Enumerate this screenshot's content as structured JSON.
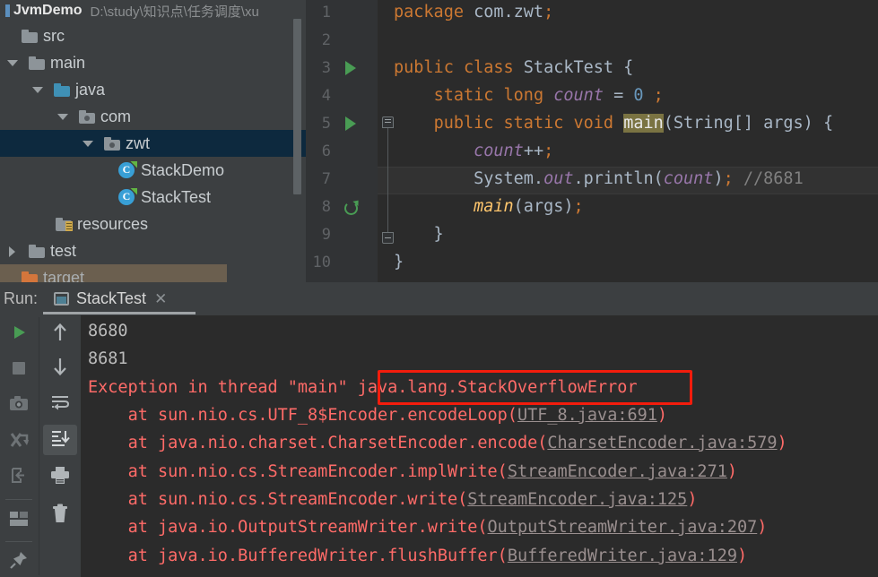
{
  "project": {
    "name": "JvmDemo",
    "path": "D:\\study\\知识点\\任务调度\\xu",
    "tree": [
      {
        "label": "src",
        "icon": "folder-icon",
        "arrow": "none",
        "indent": 8,
        "selected": false
      },
      {
        "label": "main",
        "icon": "folder-icon",
        "arrow": "down",
        "indent": 8,
        "selected": false
      },
      {
        "label": "java",
        "icon": "folder-blue-icon",
        "arrow": "down",
        "indent": 38,
        "selected": false
      },
      {
        "label": "com",
        "icon": "folder-package-icon",
        "arrow": "down",
        "indent": 68,
        "selected": false
      },
      {
        "label": "zwt",
        "icon": "folder-package-icon",
        "arrow": "down",
        "indent": 98,
        "selected": true
      },
      {
        "label": "StackDemo",
        "icon": "java-class-icon",
        "arrow": "none",
        "indent": 128,
        "selected": false
      },
      {
        "label": "StackTest",
        "icon": "java-class-icon",
        "arrow": "none",
        "indent": 128,
        "selected": false
      },
      {
        "label": "resources",
        "icon": "folder-resources-icon",
        "arrow": "none",
        "indent": 58,
        "selected": false
      },
      {
        "label": "test",
        "icon": "folder-icon",
        "arrow": "right",
        "indent": 8,
        "selected": false
      },
      {
        "label": "target",
        "icon": "folder-orange-icon",
        "arrow": "none",
        "indent": 8,
        "selected": false
      }
    ]
  },
  "editor": {
    "file": "StackTest.java",
    "line_numbers": [
      "1",
      "2",
      "3",
      "4",
      "5",
      "6",
      "7",
      "8",
      "9",
      "10"
    ],
    "code": [
      {
        "n": 1,
        "text": "package com.zwt;"
      },
      {
        "n": 2,
        "text": ""
      },
      {
        "n": 3,
        "text": "public class StackTest {"
      },
      {
        "n": 4,
        "text": "    static long count = 0 ;"
      },
      {
        "n": 5,
        "text": "    public static void main(String[] args) {"
      },
      {
        "n": 6,
        "text": "        count++;"
      },
      {
        "n": 7,
        "text": "        System.out.println(count); //8681"
      },
      {
        "n": 8,
        "text": "        main(args);"
      },
      {
        "n": 9,
        "text": "    }"
      },
      {
        "n": 10,
        "text": "}"
      }
    ],
    "comment": "//8681",
    "run_marker_lines": [
      3,
      5
    ],
    "recursion_marker_lines": [
      8
    ],
    "current_line": 7,
    "highlighted_symbol": "main"
  },
  "run_panel": {
    "label": "Run:",
    "tab_name": "StackTest",
    "tab_close": "✕",
    "toolbar_left": [
      {
        "name": "rerun-button",
        "icon": "play-icon",
        "interactable": true
      },
      {
        "name": "stop-button",
        "icon": "stop-icon",
        "interactable": true
      },
      {
        "name": "thread-dump-button",
        "icon": "camera-icon",
        "interactable": true
      },
      {
        "name": "restart-button",
        "icon": "rerun-failed-icon",
        "interactable": true
      },
      {
        "name": "export-button",
        "icon": "export-icon",
        "interactable": true
      },
      {
        "name": "layout-button",
        "icon": "layout-icon",
        "interactable": true
      },
      {
        "name": "pin-button",
        "icon": "pin-icon",
        "interactable": true
      }
    ],
    "toolbar_right": [
      {
        "name": "up-button",
        "icon": "arrow-up-icon",
        "interactable": true
      },
      {
        "name": "down-button",
        "icon": "arrow-down-icon",
        "interactable": true
      },
      {
        "name": "soft-wrap-button",
        "icon": "soft-wrap-icon",
        "interactable": true
      },
      {
        "name": "scroll-to-end-button",
        "icon": "scroll-to-end-icon",
        "interactable": true,
        "active": true
      },
      {
        "name": "print-button",
        "icon": "print-icon",
        "interactable": true
      },
      {
        "name": "clear-all-button",
        "icon": "trash-icon",
        "interactable": true
      }
    ],
    "console": [
      {
        "type": "out",
        "indent": 0,
        "text": "8680"
      },
      {
        "type": "out",
        "indent": 0,
        "text": "8681"
      },
      {
        "type": "err",
        "indent": 0,
        "text": "Exception in thread \"main\" java.lang.StackOverflowError",
        "boxed_part": "java.lang.StackOverflowError"
      },
      {
        "type": "err",
        "indent": 4,
        "text": "at sun.nio.cs.UTF_8$Encoder.encodeLoop(",
        "link": "UTF_8.java:691",
        "suffix": ")"
      },
      {
        "type": "err",
        "indent": 4,
        "text": "at java.nio.charset.CharsetEncoder.encode(",
        "link": "CharsetEncoder.java:579",
        "suffix": ")"
      },
      {
        "type": "err",
        "indent": 4,
        "text": "at sun.nio.cs.StreamEncoder.implWrite(",
        "link": "StreamEncoder.java:271",
        "suffix": ")"
      },
      {
        "type": "err",
        "indent": 4,
        "text": "at sun.nio.cs.StreamEncoder.write(",
        "link": "StreamEncoder.java:125",
        "suffix": ")"
      },
      {
        "type": "err",
        "indent": 4,
        "text": "at java.io.OutputStreamWriter.write(",
        "link": "OutputStreamWriter.java:207",
        "suffix": ")"
      },
      {
        "type": "err",
        "indent": 4,
        "text": "at java.io.BufferedWriter.flushBuffer(",
        "link": "BufferedWriter.java:129",
        "suffix": ")"
      }
    ]
  },
  "annotation": {
    "type": "red-rectangle",
    "color": "#f31c0c",
    "target_text": "java.lang.StackOverflowError"
  },
  "colors": {
    "editor_bg": "#2b2b2b",
    "gutter_bg": "#313335",
    "panel_bg": "#3c3f41",
    "selection_bg": "#0d293e",
    "error_text": "#ff6b68",
    "keyword": "#cc7832",
    "number": "#6897bb",
    "field": "#9876aa",
    "comment": "#808080",
    "accent_green": "#499c54"
  }
}
